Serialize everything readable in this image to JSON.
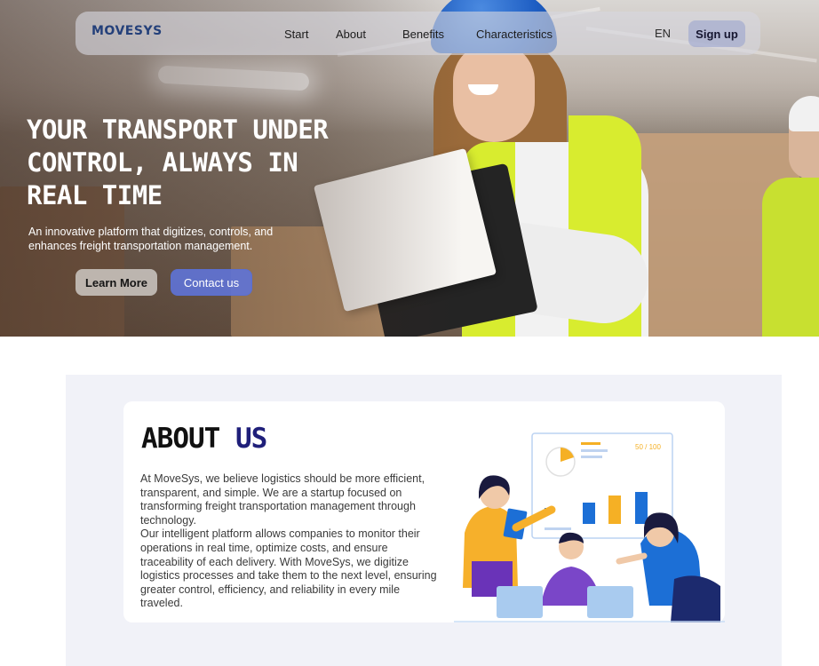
{
  "nav": {
    "logo": "MOVESYS",
    "links": [
      "Start",
      "About",
      "Benefits",
      "Characteristics"
    ],
    "language": "EN",
    "signup_label": "Sign up"
  },
  "hero": {
    "title": "YOUR TRANSPORT UNDER CONTROL, ALWAYS IN REAL TIME",
    "subtitle": "An innovative platform that digitizes, controls, and enhances freight transportation management.",
    "learn_more_label": "Learn More",
    "contact_label": "Contact us"
  },
  "about": {
    "title_main": "ABOUT",
    "title_accent": "US",
    "paragraph_1": "At MoveSys, we believe logistics should be more efficient, transparent, and simple. We are a startup focused on transforming freight transportation management through technology.",
    "paragraph_2": "Our intelligent platform allows companies to monitor their operations in real time, optimize costs, and ensure traceability of each delivery. With MoveSys, we digitize logistics processes and take them to the next level, ensuring greater control, efficiency, and reliability in every mile traveled.",
    "illustration_score": "50 / 100"
  },
  "colors": {
    "accent": "#1f1f7a",
    "brand": "#24407a",
    "contact_button": "#5f73d7",
    "section_bg": "#f1f2f8"
  }
}
